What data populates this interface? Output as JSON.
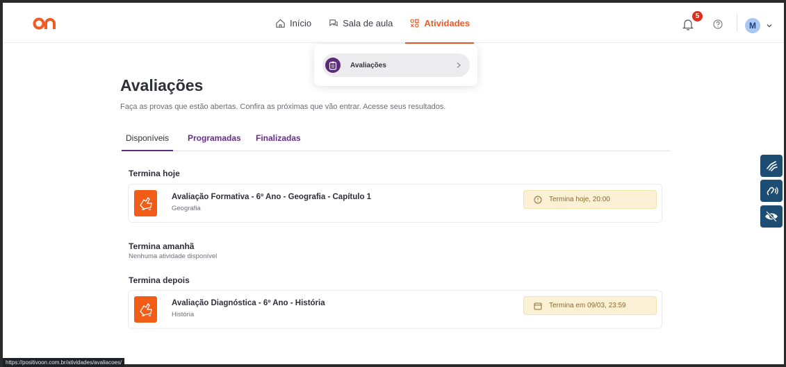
{
  "header": {
    "nav": [
      {
        "label": "Início",
        "icon": "home-icon"
      },
      {
        "label": "Sala de aula",
        "icon": "chat-icon"
      },
      {
        "label": "Atividades",
        "icon": "activities-icon",
        "active": true
      }
    ],
    "notifications_count": "5",
    "avatar_initial": "M"
  },
  "dropdown": {
    "item_label": "Avaliações"
  },
  "page": {
    "title": "Avaliações",
    "subtitle": "Faça as provas que estão abertas. Confira as próximas que vão entrar. Acesse seus resultados."
  },
  "tabs": [
    {
      "label": "Disponíveis",
      "active": true
    },
    {
      "label": "Programadas"
    },
    {
      "label": "Finalizadas"
    }
  ],
  "sections": {
    "today": {
      "title": "Termina hoje",
      "card": {
        "title": "Avaliação Formativa - 6º Ano - Geografia - Capítulo 1",
        "subject": "Geografia",
        "deadline": "Termina hoje, 20:00"
      }
    },
    "tomorrow": {
      "title": "Termina amanhã",
      "empty": "Nenhuma atividade disponível"
    },
    "later": {
      "title": "Termina depois",
      "card": {
        "title": "Avaliação Diagnóstica - 6º Ano - História",
        "subject": "História",
        "deadline": "Termina em 09/03, 23:59"
      }
    }
  },
  "status_url": "https://positivoon.com.br/atividades/avaliacoes/",
  "colors": {
    "accent": "#ef5b22",
    "purple": "#5a2b7a",
    "deadline_bg": "#fdf1d5",
    "a11y": "#1d4d72"
  }
}
